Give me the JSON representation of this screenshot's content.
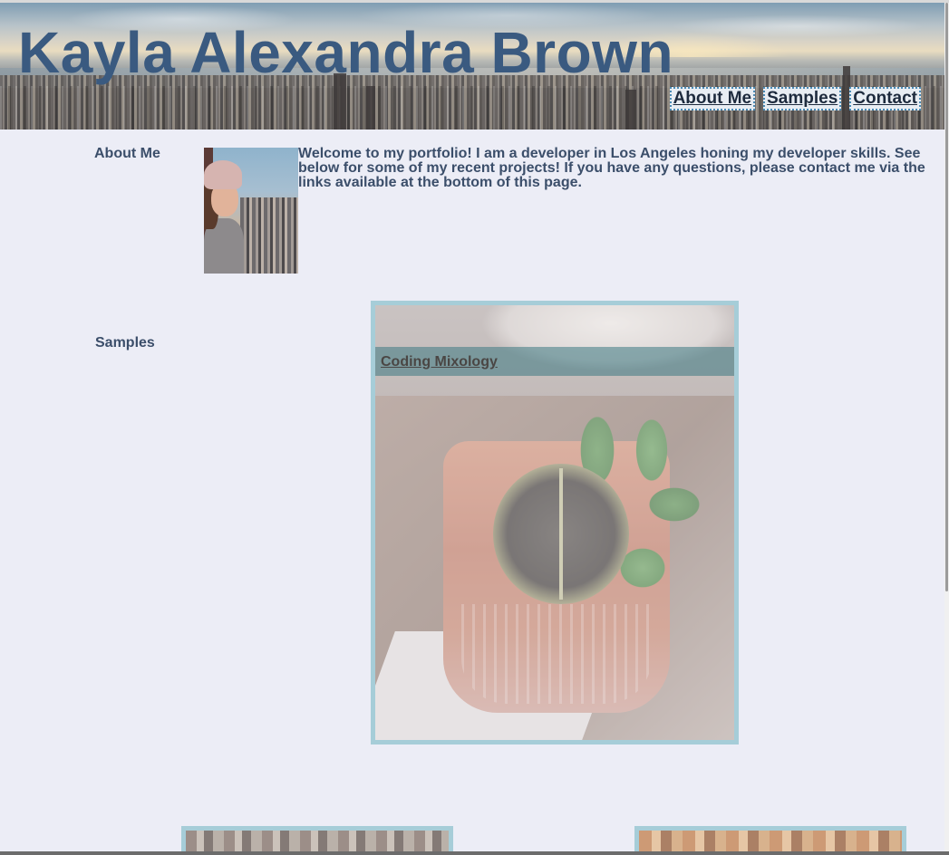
{
  "header": {
    "title": "Kayla Alexandra Brown",
    "nav": [
      {
        "label": "About Me"
      },
      {
        "label": "Samples"
      },
      {
        "label": "Contact"
      }
    ]
  },
  "about": {
    "heading": "About Me",
    "text": "Welcome to my portfolio! I am a developer in Los Angeles honing my developer skills. See below for some of my recent projects! If you have any questions, please contact me via the links available at the bottom of this page."
  },
  "samples": {
    "heading": "Samples",
    "featured": {
      "caption": "Coding Mixology"
    }
  },
  "colors": {
    "background": "#ecedf6",
    "title": "#3a5a80",
    "text": "#3b4e6a",
    "card_border": "#a6cdd8"
  }
}
